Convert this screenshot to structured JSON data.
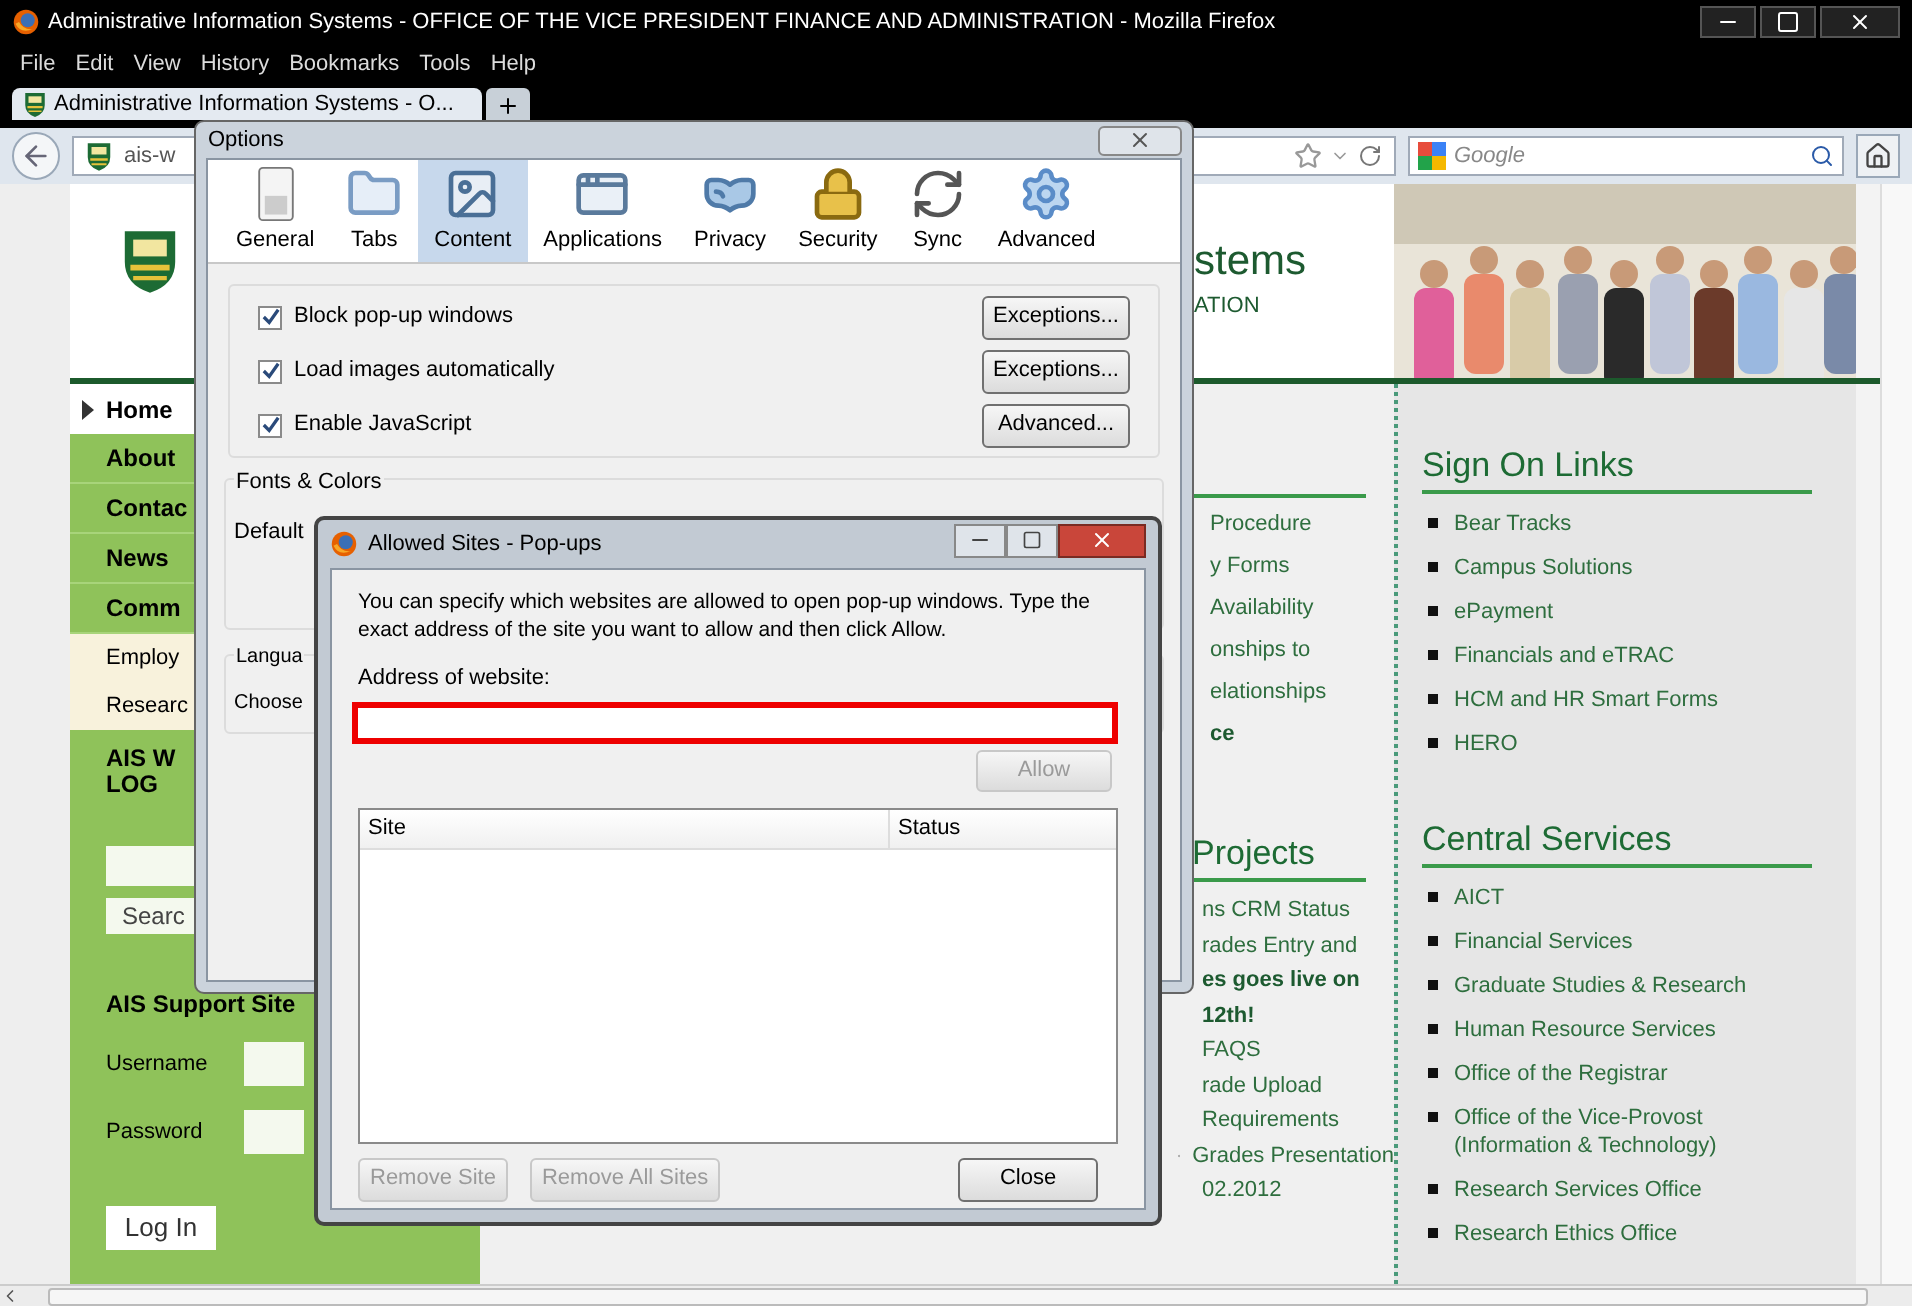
{
  "browser": {
    "title": "Administrative Information Systems - OFFICE OF THE VICE PRESIDENT FINANCE AND ADMINISTRATION - Mozilla Firefox",
    "menu": [
      "File",
      "Edit",
      "View",
      "History",
      "Bookmarks",
      "Tools",
      "Help"
    ],
    "tabs": [
      {
        "label": "Administrative Information Systems - O...",
        "selected": true
      }
    ],
    "url": "ais-w",
    "search": {
      "placeholder": "Google"
    }
  },
  "page": {
    "header": {
      "title": "stems",
      "subtitle": "ATION"
    },
    "nav": [
      {
        "label": "Home",
        "kind": "main",
        "selected": true
      },
      {
        "label": "About",
        "kind": "main",
        "selected": false
      },
      {
        "label": "Contac",
        "kind": "main",
        "selected": false
      },
      {
        "label": "News",
        "kind": "main",
        "selected": false
      },
      {
        "label": "Comm",
        "kind": "main",
        "selected": false
      },
      {
        "label": "Employ",
        "kind": "sub",
        "selected": false
      },
      {
        "label": "Researc",
        "kind": "sub",
        "selected": false
      }
    ],
    "search_box": {
      "heading": [
        "AIS W",
        "LOG"
      ],
      "button": "Searc"
    },
    "login": {
      "heading": "AIS Support Site",
      "username_label": "Username",
      "password_label": "Password",
      "button": "Log In"
    },
    "middle_top": [
      {
        "text": "Procedure",
        "kind": "link"
      },
      {
        "text": "y Forms",
        "kind": "link"
      },
      {
        "text": "Availability",
        "kind": "link"
      },
      {
        "text": "onships to",
        "kind": "link"
      },
      {
        "text": "elationships",
        "kind": "link"
      },
      {
        "text": "ce",
        "kind": "bold"
      }
    ],
    "projects_heading": "Projects",
    "middle_projects": [
      {
        "text": "ns CRM Status",
        "kind": "link"
      },
      {
        "text": "rades Entry and",
        "kind": "link"
      },
      {
        "text": "es goes live on",
        "kind": "bold"
      },
      {
        "text": "12th!",
        "kind": "bold"
      },
      {
        "text": "FAQS",
        "kind": "link"
      },
      {
        "text": "rade Upload",
        "kind": "link"
      },
      {
        "text": "Requirements",
        "kind": "link"
      },
      {
        "text": "Grades Presentation",
        "kind": "bullet"
      },
      {
        "text": "02.2012",
        "kind": "link"
      }
    ],
    "sidebar": [
      {
        "heading": "Sign On Links",
        "items": [
          "Bear Tracks",
          "Campus Solutions",
          "ePayment",
          "Financials and eTRAC",
          "HCM and HR Smart Forms",
          "HERO"
        ]
      },
      {
        "heading": "Central Services",
        "items": [
          "AICT",
          "Financial Services",
          "Graduate Studies & Research",
          "Human Resource Services",
          "Office of the Registrar",
          "Office of the Vice-Provost (Information & Technology)",
          "Research Services Office",
          "Research Ethics Office"
        ]
      }
    ]
  },
  "options_dialog": {
    "title": "Options",
    "toolbar": [
      {
        "label": "General",
        "selected": false
      },
      {
        "label": "Tabs",
        "selected": false
      },
      {
        "label": "Content",
        "selected": true
      },
      {
        "label": "Applications",
        "selected": false
      },
      {
        "label": "Privacy",
        "selected": false
      },
      {
        "label": "Security",
        "selected": false
      },
      {
        "label": "Sync",
        "selected": false
      },
      {
        "label": "Advanced",
        "selected": false
      }
    ],
    "checks": [
      {
        "label": "Block pop-up windows",
        "checked": true,
        "button": "Exceptions..."
      },
      {
        "label": "Load images automatically",
        "checked": true,
        "button": "Exceptions..."
      },
      {
        "label": "Enable JavaScript",
        "checked": true,
        "button": "Advanced..."
      }
    ],
    "fonts_group": {
      "legend": "Fonts & Colors",
      "label": "Default"
    },
    "language_group": {
      "legend": "Langua",
      "label": "Choose"
    }
  },
  "allowed_dialog": {
    "title": "Allowed Sites - Pop-ups",
    "description": "You can specify which websites are allowed to open pop-up windows. Type the exact address of the site you want to allow and then click Allow.",
    "address_label": "Address of website:",
    "allow_button": {
      "label": "Allow",
      "disabled": true
    },
    "columns": [
      "Site",
      "Status"
    ],
    "buttons": [
      {
        "label": "Remove Site",
        "disabled": true
      },
      {
        "label": "Remove All Sites",
        "disabled": true
      },
      {
        "label": "Close",
        "disabled": false
      }
    ]
  }
}
